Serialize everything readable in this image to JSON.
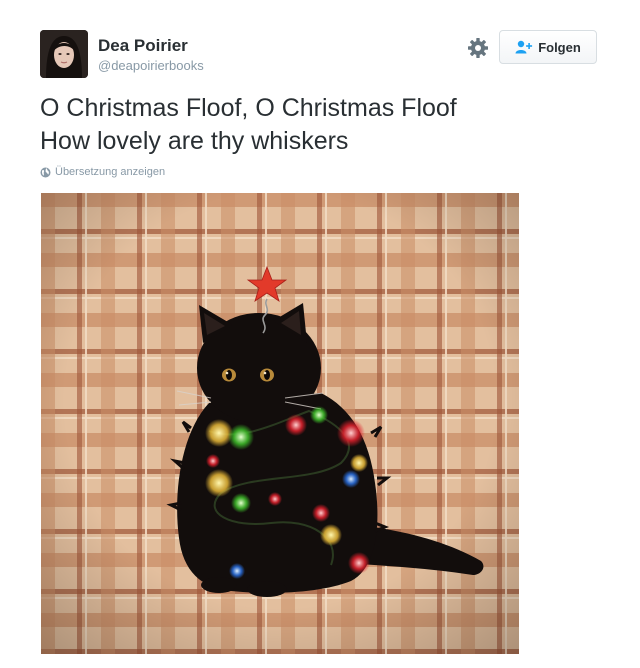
{
  "author": {
    "display_name": "Dea Poirier",
    "handle": "@deapoirierbooks"
  },
  "actions": {
    "follow_label": "Folgen",
    "settings_icon": "gear-icon",
    "follow_icon": "add-user-icon"
  },
  "tweet": {
    "lines": [
      "O Christmas Floof, O Christmas Floof",
      "How lovely are thy whiskers"
    ],
    "translate_label": "Übersetzung anzeigen",
    "translate_icon": "globe-icon"
  },
  "media": {
    "subject": "black-cat-with-christmas-lights-photo",
    "colors": {
      "blanket": "#d9b08c",
      "stripe": "#a35a3e",
      "cat": "#120d0c",
      "star": "#e23a2a",
      "accent": "#1da1f2"
    }
  }
}
